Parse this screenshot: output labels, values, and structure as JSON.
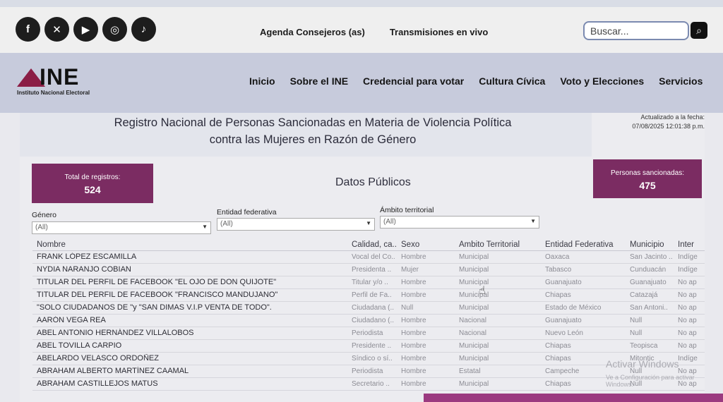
{
  "social": [
    {
      "icon": "facebook-icon",
      "glyph": "f"
    },
    {
      "icon": "x-icon",
      "glyph": "✕"
    },
    {
      "icon": "youtube-icon",
      "glyph": "▶"
    },
    {
      "icon": "instagram-icon",
      "glyph": "◎"
    },
    {
      "icon": "tiktok-icon",
      "glyph": "♪"
    }
  ],
  "toplinks": [
    "Agenda Consejeros (as)",
    "Transmisiones en vivo"
  ],
  "search": {
    "placeholder": "Buscar..."
  },
  "logo": {
    "word": "INE",
    "sub": "Instituto Nacional Electoral"
  },
  "nav": [
    "Inicio",
    "Sobre el INE",
    "Credencial para votar",
    "Cultura Cívica",
    "Voto y Elecciones",
    "Servicios"
  ],
  "title_line1": "Registro Nacional de Personas Sancionadas en Materia de Violencia Política",
  "title_line2": "contra las Mujeres en Razón de Género",
  "updated_label": "Actualizado a la fecha:",
  "updated_value": "07/08/2025 12:01:38 p.m.",
  "total": {
    "label": "Total de registros:",
    "value": "524"
  },
  "sanctioned": {
    "label": "Personas sancionadas:",
    "value": "475"
  },
  "section_title": "Datos Públicos",
  "filters": [
    {
      "label": "Género",
      "value": "(All)"
    },
    {
      "label": "Entidad federativa",
      "value": "(All)"
    },
    {
      "label": "Ámbito territorial",
      "value": "(All)"
    }
  ],
  "columns": [
    "Nombre",
    "Calidad, ca..",
    "Sexo",
    "Ámbito Territorial",
    "Entidad Federativa",
    "Municipio",
    "Inter"
  ],
  "rows": [
    [
      "FRANK LÓPEZ ESCAMILLA",
      "Vocal del Co..",
      "Hombre",
      "Municipal",
      "Oaxaca",
      "San Jacinto ..",
      "Indíge"
    ],
    [
      "NYDIA NARANJO COBIAN",
      "Presidenta ..",
      "Mujer",
      "Municipal",
      "Tabasco",
      "Cunduacán",
      "Indíge"
    ],
    [
      "TITULAR DEL PERFIL DE FACEBOOK \"EL OJO DE DON QUIJOTE\"",
      "Titular y/o ..",
      "Hombre",
      "Municipal",
      "Guanajuato",
      "Guanajuato",
      "No ap"
    ],
    [
      "TITULAR DEL PERFIL DE FACEBOOK \"FRANCISCO MANDUJANO\"",
      "Perfil de Fa..",
      "Hombre",
      "Municipal",
      "Chiapas",
      "Catazajá",
      "No ap"
    ],
    [
      "\"SOLO CIUDADANOS DE \"y \"SAN DIMAS V.I.P VENTA DE TODO\".",
      "Ciudadana (..",
      "Null",
      "Municipal",
      "Estado de México",
      "San Antoni..",
      "No ap"
    ],
    [
      "AARÓN VEGA REA",
      "Ciudadano (..",
      "Hombre",
      "Nacional",
      "Guanajuato",
      "Null",
      "No ap"
    ],
    [
      "ABEL ANTONIO HERNÁNDEZ VILLALOBOS",
      "Periodista",
      "Hombre",
      "Nacional",
      "Nuevo León",
      "Null",
      "No ap"
    ],
    [
      "ABEL TOVILLA CARPIO",
      "Presidente ..",
      "Hombre",
      "Municipal",
      "Chiapas",
      "Teopisca",
      "No ap"
    ],
    [
      "ABELARDO VELASCO ORDOÑEZ",
      "Síndico o sí..",
      "Hombre",
      "Municipal",
      "Chiapas",
      "Mitontic",
      "Indíge"
    ],
    [
      "ABRAHAM ALBERTO MARTÍNEZ CAAMAL",
      "Periodista",
      "Hombre",
      "Estatal",
      "Campeche",
      "Null",
      "No ap"
    ],
    [
      "ABRAHAM CASTILLEJOS MATUS",
      "Secretario ..",
      "Hombre",
      "Municipal",
      "Chiapas",
      "Null",
      "No ap"
    ]
  ],
  "watermark1": "Activar Windows",
  "watermark2": "Ve a Configuración para activar Windows."
}
